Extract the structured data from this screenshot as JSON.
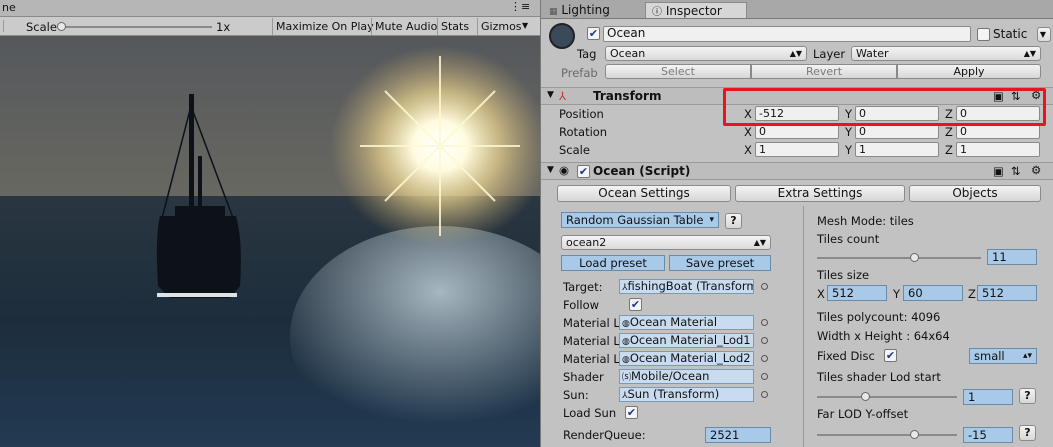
{
  "game": {
    "tab_fragment": "ne",
    "scale_label": "Scale",
    "scale_value": "1x",
    "scale_level": 0,
    "toolbar": [
      "Maximize On Play",
      "Mute Audio",
      "Stats",
      "Gizmos"
    ]
  },
  "inspector": {
    "tabs": [
      "Lighting",
      "Inspector"
    ],
    "object_name": "Ocean",
    "static_label": "Static",
    "tag_label": "Tag",
    "tag_value": "Ocean",
    "layer_label": "Layer",
    "layer_value": "Water",
    "prefab_label": "Prefab",
    "prefab_buttons": [
      "Select",
      "Revert",
      "Apply"
    ],
    "transform": {
      "title": "Transform",
      "rows": [
        {
          "label": "Position",
          "x": "-512",
          "y": "0",
          "z": "0"
        },
        {
          "label": "Rotation",
          "x": "0",
          "y": "0",
          "z": "0"
        },
        {
          "label": "Scale",
          "x": "1",
          "y": "1",
          "z": "1"
        }
      ],
      "axis": [
        "X",
        "Y",
        "Z"
      ]
    },
    "script": {
      "title": "Ocean (Script)",
      "tabs": [
        "Ocean Settings",
        "Extra Settings",
        "Objects"
      ],
      "left": {
        "table_dropdown": "Random Gaussian Table",
        "help": "?",
        "preset_dropdown": "ocean2",
        "load_preset": "Load preset",
        "save_preset": "Save preset",
        "fields": [
          {
            "label": "Target:",
            "value": "fishingBoat (Transform)"
          },
          {
            "label": "Follow",
            "check": true
          },
          {
            "label": "Material L",
            "value": "Ocean Material"
          },
          {
            "label": "Material L",
            "value": "Ocean Material_Lod1"
          },
          {
            "label": "Material L",
            "value": "Ocean Material_Lod2"
          },
          {
            "label": "Shader",
            "value": "Mobile/Ocean"
          },
          {
            "label": "Sun:",
            "value": "Sun (Transform)"
          },
          {
            "label": "Load Sun",
            "check": true
          }
        ],
        "render_queue_label": "RenderQueue:",
        "render_queue_value": "2521"
      },
      "right": {
        "mesh_mode": "Mesh Mode:   tiles",
        "tiles_count_label": "Tiles count",
        "tiles_count": "11",
        "tiles_count_level": 0.6,
        "tiles_size_label": "Tiles size",
        "tiles_size": {
          "x": "512",
          "y": "60",
          "z": "512"
        },
        "polycount": "Tiles polycount: 4096",
        "wh": "Width x Height :  64x64",
        "fixed_disc_label": "Fixed Disc",
        "fixed_disc_dropdown": "small",
        "lod_start_label": "Tiles shader Lod start",
        "lod_start": "1",
        "lod_start_level": 0.35,
        "far_lod_label": "Far LOD Y-offset",
        "far_lod": "-15",
        "far_lod_level": 0.7,
        "help": "?"
      }
    }
  },
  "colors": {
    "highlight": "#e8151d",
    "selected_tab": "#d6d6d6"
  }
}
